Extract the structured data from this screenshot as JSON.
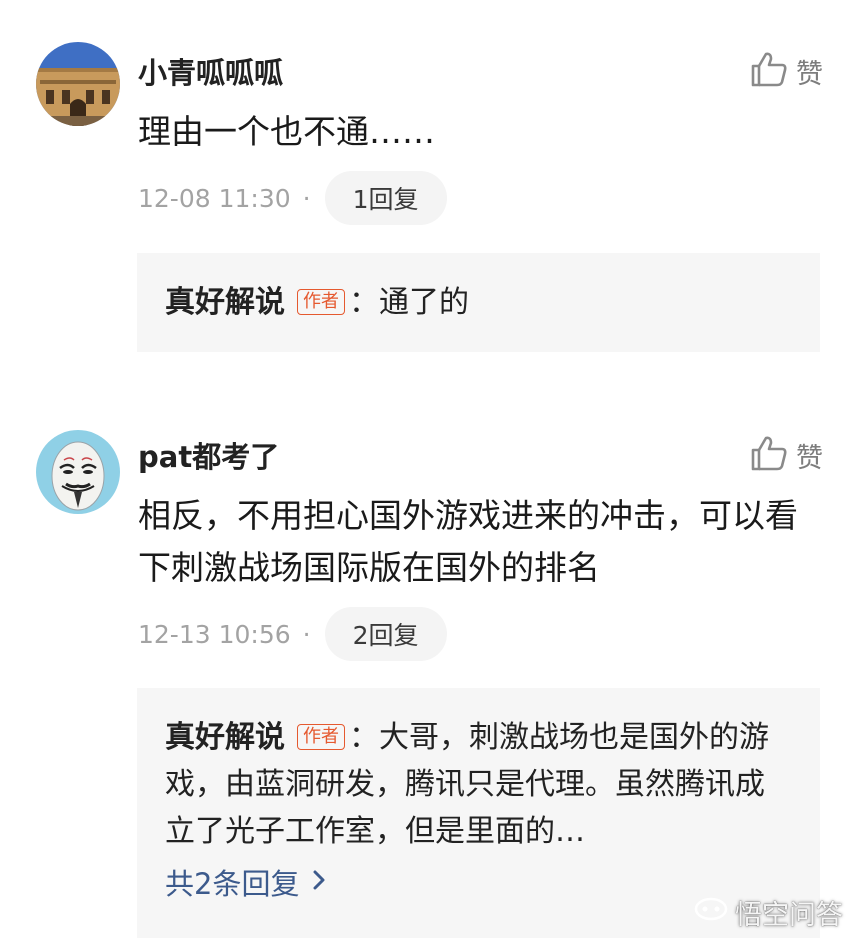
{
  "comments": [
    {
      "username": "小青呱呱呱",
      "like_label": "赞",
      "text": "理由一个也不通……",
      "time": "12-08 11:30",
      "separator": "·",
      "reply_count_label": "1回复",
      "reply": {
        "author": "真好解说",
        "badge": "作者",
        "text": "：通了的"
      }
    },
    {
      "username": "pat都考了",
      "like_label": "赞",
      "text": "相反，不用担心国外游戏进来的冲击，可以看下刺激战场国际版在国外的排名",
      "time": "12-13 10:56",
      "separator": "·",
      "reply_count_label": "2回复",
      "reply": {
        "author": "真好解说",
        "badge": "作者",
        "text": "：大哥，刺激战场也是国外的游戏，由蓝洞研发，腾讯只是代理。虽然腾讯成立了光子工作室，但是里面的…"
      },
      "see_all_label": "共2条回复"
    }
  ],
  "watermark": "悟空问答",
  "colors": {
    "accent_orange": "#e5592f",
    "link_blue": "#3c5a8c",
    "meta_gray": "#a3a3a3",
    "reply_bg": "#f6f6f6"
  },
  "icons": [
    "thumbs-up-icon",
    "chevron-right-icon",
    "wukong-logo-icon"
  ]
}
